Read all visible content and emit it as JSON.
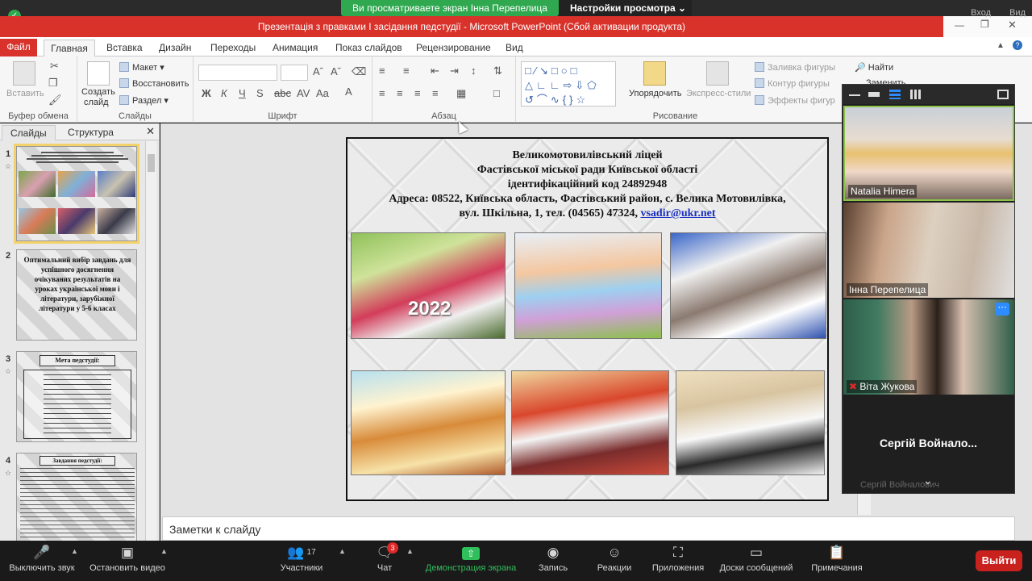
{
  "zoom_share": {
    "banner": "Ви просматриваете экран Інна Перепелица",
    "settings": "Настройки просмотра",
    "enter": "Вход",
    "view": "Вид"
  },
  "ppt": {
    "title": "Презентація з правками I засідання педстудії  -  Microsoft PowerPoint (Сбой активации продукта)",
    "tabs": {
      "file": "Файл",
      "home": "Главная",
      "insert": "Вставка",
      "design": "Дизайн",
      "transitions": "Переходы",
      "animation": "Анимация",
      "slideshow": "Показ слайдов",
      "review": "Рецензирование",
      "view": "Вид"
    },
    "ribbon": {
      "clipboard_label": "Буфер обмена",
      "paste": "Вставить",
      "slides_label": "Слайды",
      "new_slide": "Создать",
      "new_slide2": "слайд",
      "layout": "Макет",
      "reset": "Восстановить",
      "section": "Раздел",
      "font_label": "Шрифт",
      "paragraph_label": "Абзац",
      "drawing_label": "Рисование",
      "arrange": "Упорядочить",
      "quick_styles": "Экспресс-стили",
      "shape_fill": "Заливка фигуры",
      "shape_outline": "Контур фигуры",
      "shape_effects": "Эффекты фигур",
      "find": "Найти",
      "replace": "Заменить"
    },
    "panel": {
      "tab_slides": "Слайды",
      "tab_outline": "Структура",
      "slide_numbers": [
        "1",
        "2",
        "3",
        "4"
      ],
      "thumb2_text": "Оптимальний вибір завдань для успішного досягнення очікуваних результатів на уроках української мови і літератури, зарубіжної літератури у 5-6 класах",
      "thumb3_title": "Мета педстудії:",
      "thumb4_title": "Завдання педстудії:"
    },
    "slide": {
      "line1": "Великомотовилівський ліцей",
      "line2": "Фастівської міської  ради Київської області",
      "line3": "ідентифікаційний код 24892948",
      "line4": "Адреса: 08522, Київська область, Фастівський район, с. Велика Мотовилівка,",
      "line5": "вул. Шкільна, 1, тел. (04565) 47324,",
      "email": "vsadir@ukr.net",
      "photo1_label": "2022"
    },
    "notes": "Заметки к слайду"
  },
  "gallery": {
    "p1": "Natalia Himera",
    "p2": "Інна Перепелица",
    "p3": "Віта Жукова",
    "p4": "Сергій  Войнало...",
    "p4_sub": "Сергій Войналович"
  },
  "toolbar": {
    "mute": "Выключить звук",
    "video": "Остановить видео",
    "participants": "Участники",
    "participants_count": "17",
    "chat": "Чат",
    "chat_badge": "3",
    "share": "Демонстрация экрана",
    "record": "Запись",
    "reactions": "Реакции",
    "apps": "Приложения",
    "whiteboards": "Доски сообщений",
    "notes": "Примечания",
    "leave": "Выйти"
  }
}
